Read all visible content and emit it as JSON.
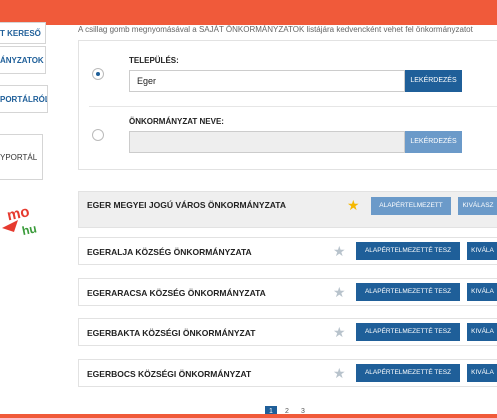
{
  "header": {
    "notice": "A csillag gomb megnyomásával a SAJÁT ÖNKORMÁNYZATOK listájára kedvencként vehet fel önkormányzatot"
  },
  "sidebar": {
    "items": [
      {
        "label": "T KERESŐ"
      },
      {
        "label": "ÁNYZATOK"
      },
      {
        "label": "PORTÁLRÓL"
      },
      {
        "label": "YPORTÁL"
      }
    ],
    "logo_text": "mo hu"
  },
  "search": {
    "telepules_label": "TELEPÜLÉS:",
    "telepules_value": "Eger",
    "onkormanyzat_label": "ÖNKORMÁNYZAT NEVE:",
    "onkormanyzat_value": "",
    "query_button": "LEKÉRDEZÉS"
  },
  "results": [
    {
      "name": "EGER MEGYEI JOGÚ VÁROS ÖNKORMÁNYZATA",
      "favorite": true,
      "default_button": "ALAPÉRTELMEZETT",
      "select_button": "KIVÁLASZ"
    },
    {
      "name": "EGERALJA KÖZSÉG ÖNKORMÁNYZATA",
      "favorite": false,
      "default_button": "ALAPÉRTELMEZETTÉ TESZ",
      "select_button": "KIVÁLA"
    },
    {
      "name": "EGERARACSA KÖZSÉG ÖNKORMÁNYZATA",
      "favorite": false,
      "default_button": "ALAPÉRTELMEZETTÉ TESZ",
      "select_button": "KIVÁLA"
    },
    {
      "name": "EGERBAKTA KÖZSÉGI ÖNKORMÁNYZAT",
      "favorite": false,
      "default_button": "ALAPÉRTELMEZETTÉ TESZ",
      "select_button": "KIVÁLA"
    },
    {
      "name": "EGERBOCS KÖZSÉGI ÖNKORMÁNYZAT",
      "favorite": false,
      "default_button": "ALAPÉRTELMEZETTÉ TESZ",
      "select_button": "KIVÁLA"
    }
  ],
  "pagination": [
    "1",
    "2",
    "3"
  ],
  "colors": {
    "accent": "#f05a3a",
    "primary": "#1f5f99",
    "star": "#f5b800"
  }
}
